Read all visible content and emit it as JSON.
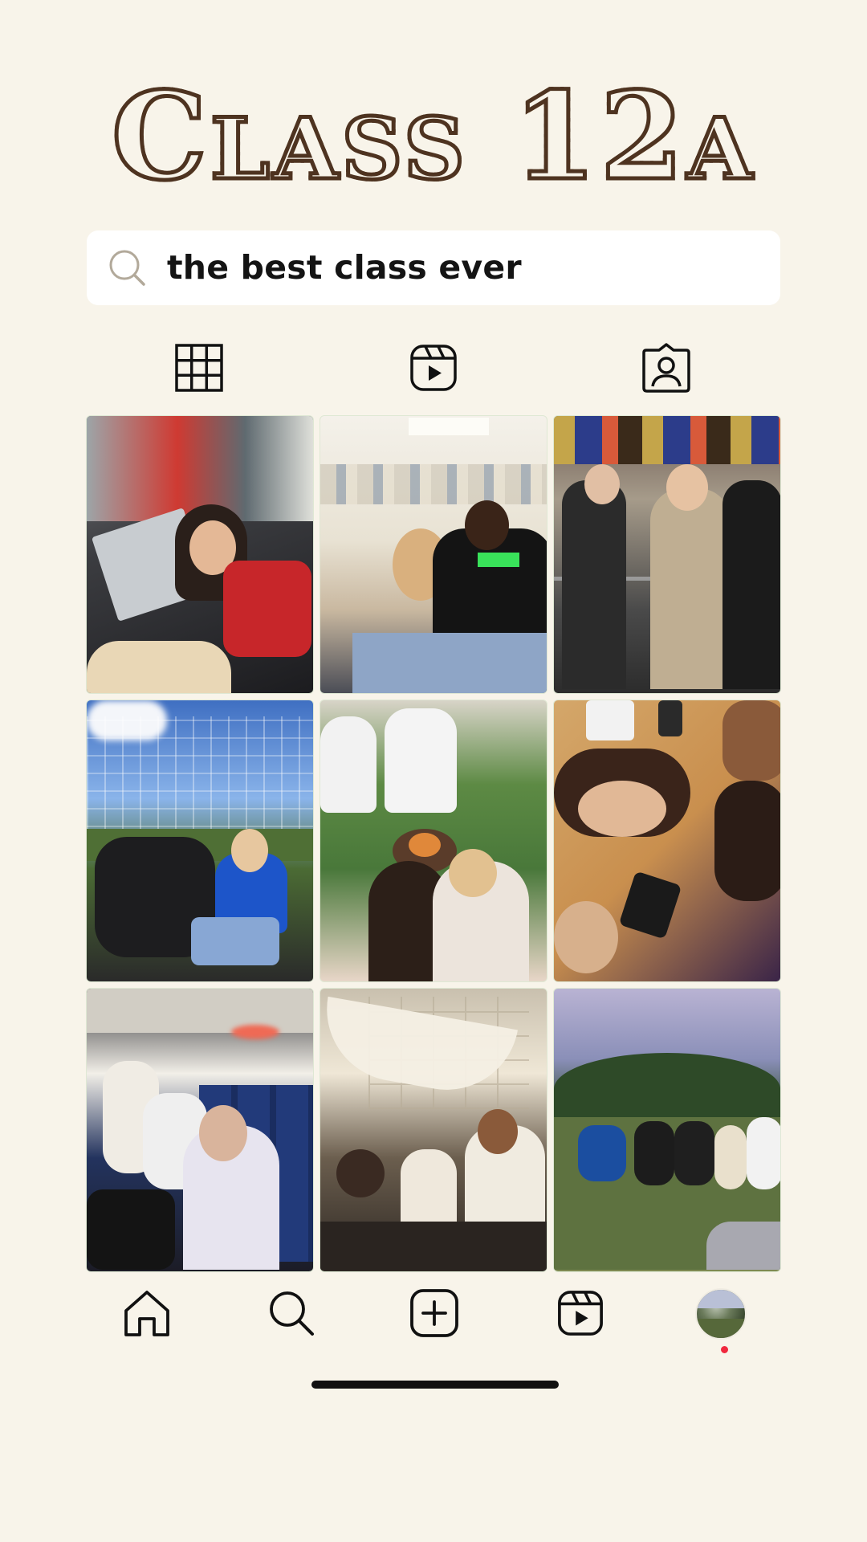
{
  "profile": {
    "title": "Class 12a"
  },
  "search": {
    "query": "the best class ever"
  },
  "tabs": [
    {
      "name": "grid",
      "icon": "grid-icon",
      "active": true
    },
    {
      "name": "reels",
      "icon": "reels-icon",
      "active": false
    },
    {
      "name": "tagged",
      "icon": "tagged-icon",
      "active": false
    }
  ],
  "posts": [
    {
      "icon": "photo",
      "scene": "classroom-selfie"
    },
    {
      "icon": "photo",
      "scene": "classroom-peace-sign"
    },
    {
      "icon": "photo",
      "scene": "group-hallway"
    },
    {
      "icon": "photo",
      "scene": "field-fence-group"
    },
    {
      "icon": "photo",
      "scene": "campfire-garden"
    },
    {
      "icon": "photo",
      "scene": "table-nap"
    },
    {
      "icon": "photo",
      "scene": "airplane-selfie"
    },
    {
      "icon": "photo",
      "scene": "courtyard-group"
    },
    {
      "icon": "photo",
      "scene": "park-picnic"
    }
  ],
  "bottom_nav": [
    {
      "name": "home",
      "icon": "home-icon"
    },
    {
      "name": "search",
      "icon": "search-icon"
    },
    {
      "name": "create",
      "icon": "plus-square-icon"
    },
    {
      "name": "reels",
      "icon": "reels-icon"
    },
    {
      "name": "profile",
      "icon": "avatar"
    }
  ],
  "colors": {
    "background": "#f8f4ea",
    "title": "#4e3320",
    "notification_dot": "#f0283e"
  }
}
